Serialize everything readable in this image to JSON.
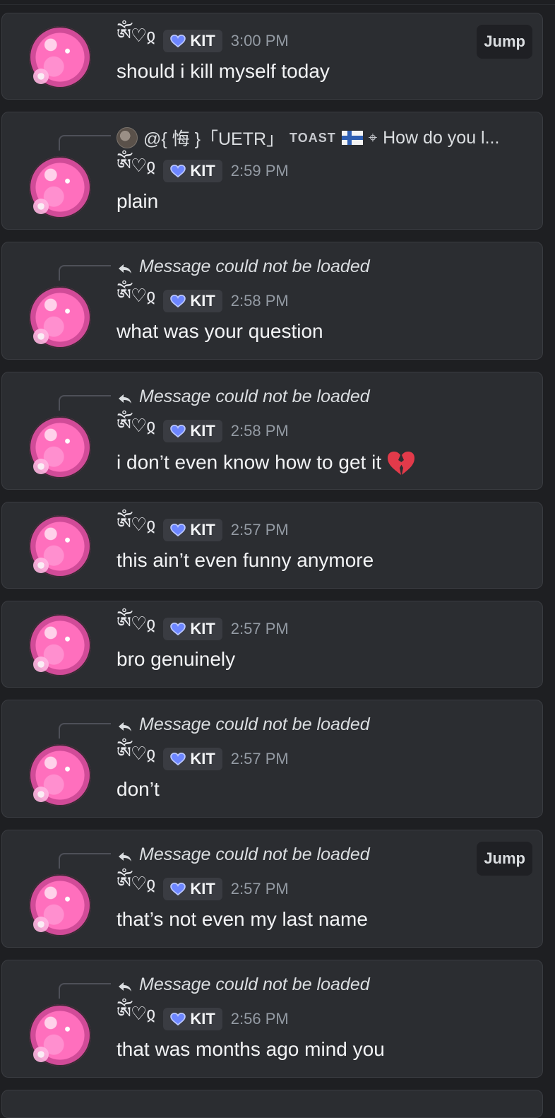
{
  "messages": [
    {
      "reply": null,
      "wings": "ༀ♡ჲ",
      "tag": "KIT",
      "time": "3:00 PM",
      "text": "should i kill myself today",
      "jump": "Jump"
    },
    {
      "reply": {
        "type": "user",
        "user": "@{ 悔 }「UETR」",
        "tag": "TOAST",
        "flag": "Finland flag",
        "icon": "⌖",
        "preview": "How do you l..."
      },
      "wings": "ༀ♡ჲ",
      "tag": "KIT",
      "time": "2:59 PM",
      "text": "plain",
      "jump": ""
    },
    {
      "reply": {
        "type": "missing",
        "text": "Message could not be loaded"
      },
      "wings": "ༀ♡ჲ",
      "tag": "KIT",
      "time": "2:58 PM",
      "text": "what was your question",
      "jump": ""
    },
    {
      "reply": {
        "type": "missing",
        "text": "Message could not be loaded"
      },
      "wings": "ༀ♡ჲ",
      "tag": "KIT",
      "time": "2:58 PM",
      "text": "i don’t even know how to get it",
      "emoji": "broken-heart",
      "jump": ""
    },
    {
      "reply": null,
      "wings": "ༀ♡ჲ",
      "tag": "KIT",
      "time": "2:57 PM",
      "text": "this ain’t even funny anymore",
      "jump": ""
    },
    {
      "reply": null,
      "wings": "ༀ♡ჲ",
      "tag": "KIT",
      "time": "2:57 PM",
      "text": "bro genuinely",
      "jump": ""
    },
    {
      "reply": {
        "type": "missing",
        "text": "Message could not be loaded"
      },
      "wings": "ༀ♡ჲ",
      "tag": "KIT",
      "time": "2:57 PM",
      "text": "don’t",
      "jump": ""
    },
    {
      "reply": {
        "type": "missing",
        "text": "Message could not be loaded"
      },
      "wings": "ༀ♡ჲ",
      "tag": "KIT",
      "time": "2:57 PM",
      "text": "that’s not even my last name",
      "jump": "Jump"
    },
    {
      "reply": {
        "type": "missing",
        "text": "Message could not be loaded"
      },
      "wings": "ༀ♡ჲ",
      "tag": "KIT",
      "time": "2:56 PM",
      "text": "that was months ago mind you",
      "jump": ""
    }
  ],
  "colors": {
    "background": "#1e1f22",
    "card": "#2b2d31",
    "tag_bg": "#3a3c42",
    "time": "#949ba4",
    "heart_blue": "#5c7cff"
  },
  "icons": {
    "reply": "reply-arrow-icon",
    "tag": "blue-heart-icon",
    "emoji": "broken-heart-emoji"
  }
}
